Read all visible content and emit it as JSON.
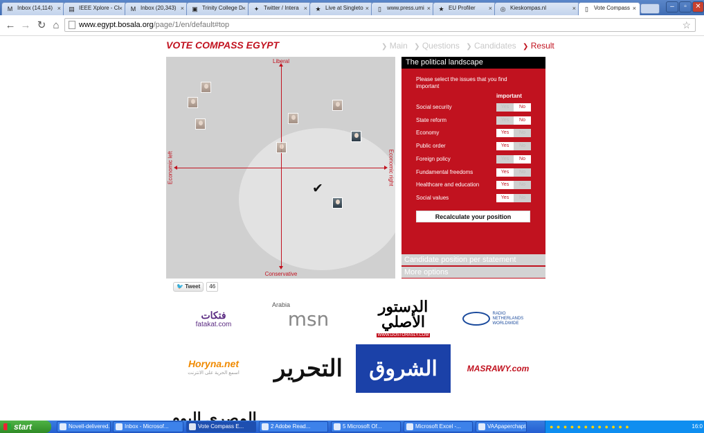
{
  "browser": {
    "tabs": [
      {
        "icon": "gmail-icon",
        "label": "Inbox (14,114)",
        "active": false
      },
      {
        "icon": "ieee-icon",
        "label": "IEEE Xplore - Cl",
        "active": false
      },
      {
        "icon": "gmail-icon",
        "label": "Inbox (20,343)",
        "active": false
      },
      {
        "icon": "tcd-icon",
        "label": "Trinity College D",
        "active": false
      },
      {
        "icon": "twitter-icon",
        "label": "Twitter / Intera",
        "active": false
      },
      {
        "icon": "star-icon",
        "label": "Live at Singleto",
        "active": false
      },
      {
        "icon": "page-icon",
        "label": "www.press.umi",
        "active": false
      },
      {
        "icon": "star-icon",
        "label": "EU Profiler",
        "active": false
      },
      {
        "icon": "compass-icon",
        "label": "Kieskompas.nl",
        "active": false
      },
      {
        "icon": "page-icon",
        "label": "Vote Compass",
        "active": true
      }
    ],
    "url_host": "www.egypt.bosala.org",
    "url_path": "/page/1/en/default#top"
  },
  "page": {
    "brand": "VOTE COMPASS EGYPT",
    "steps": [
      {
        "label": "Main",
        "current": false
      },
      {
        "label": "Questions",
        "current": false
      },
      {
        "label": "Candidates",
        "current": false
      },
      {
        "label": "Result",
        "current": true
      }
    ],
    "map": {
      "top_label": "Liberal",
      "bottom_label": "Conservative",
      "left_label": "Economic left",
      "right_label": "Economic right"
    },
    "panel": {
      "title": "The political landscape",
      "intro": "Please select the issues that you find important",
      "important_header": "important",
      "yes_label": "Yes",
      "no_label": "No",
      "issues": [
        {
          "name": "Social security",
          "important": false
        },
        {
          "name": "State reform",
          "important": false
        },
        {
          "name": "Economy",
          "important": true
        },
        {
          "name": "Public order",
          "important": true
        },
        {
          "name": "Foreign policy",
          "important": false
        },
        {
          "name": "Fundamental freedoms",
          "important": true
        },
        {
          "name": "Healthcare and education",
          "important": true
        },
        {
          "name": "Social values",
          "important": true
        }
      ],
      "recalculate": "Recalculate your position",
      "option_candidate": "Candidate position per statement",
      "option_more": "More options"
    },
    "tweet": {
      "label": "Tweet",
      "count": "46"
    },
    "logos": [
      {
        "name": "fatakat-logo",
        "text": "فتكات",
        "sub": "fatakat.com"
      },
      {
        "name": "msn-arabia-logo",
        "text": "msn",
        "sub": "Arabia"
      },
      {
        "name": "dostor-logo",
        "text": "الدستور الأصلي",
        "sub": "WWW.DOSTORASLY.COM"
      },
      {
        "name": "rnw-logo",
        "text": "RADIO NETHERLANDS WORLDWIDE",
        "sub": ""
      },
      {
        "name": "horyna-logo",
        "text": "Horyna.net",
        "sub": "اسمع الحرية على الانترنت"
      },
      {
        "name": "tahrir-logo",
        "text": "التحرير",
        "sub": ""
      },
      {
        "name": "shorouk-logo",
        "text": "الشروق",
        "sub": ""
      },
      {
        "name": "masrawy-logo",
        "text": "MASRAWY.com",
        "sub": ""
      },
      {
        "name": "almasry-alyoum-logo",
        "text": "المصري اليوم",
        "sub": ""
      }
    ]
  },
  "taskbar": {
    "start": "start",
    "buttons": [
      {
        "label": "Novell-delivered...",
        "active": false
      },
      {
        "label": "Inbox - Microsof...",
        "active": false
      },
      {
        "label": "Vote Compass E...",
        "active": true
      },
      {
        "label": "2 Adobe Read...",
        "active": false
      },
      {
        "label": "5 Microsoft Of...",
        "active": false
      },
      {
        "label": "Microsoft Excel -...",
        "active": false
      },
      {
        "label": "VAApaperchapter",
        "active": false
      }
    ],
    "clock": "16:0"
  }
}
